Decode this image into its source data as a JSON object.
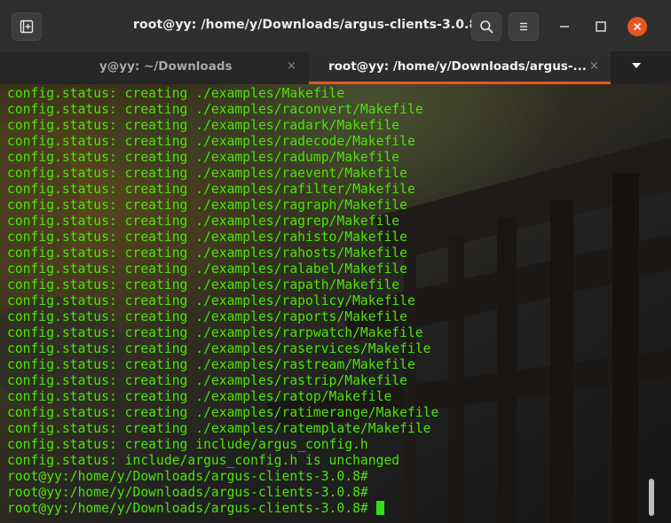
{
  "window": {
    "title": "root@yy: /home/y/Downloads/argus-clients-3.0.8"
  },
  "titlebar": {
    "new_tab_icon": "new-tab-icon",
    "search_icon": "search-icon",
    "menu_icon": "hamburger-menu-icon",
    "minimize_icon": "minimize-icon",
    "maximize_icon": "maximize-icon",
    "close_icon": "close-icon"
  },
  "tabs": [
    {
      "label": "y@yy: ~/Downloads",
      "close": "×",
      "active": false
    },
    {
      "label": "root@yy: /home/y/Downloads/argus-...",
      "close": "×",
      "active": true
    }
  ],
  "terminal": {
    "lines": [
      "config.status: creating ./examples/Makefile",
      "config.status: creating ./examples/raconvert/Makefile",
      "config.status: creating ./examples/radark/Makefile",
      "config.status: creating ./examples/radecode/Makefile",
      "config.status: creating ./examples/radump/Makefile",
      "config.status: creating ./examples/raevent/Makefile",
      "config.status: creating ./examples/rafilter/Makefile",
      "config.status: creating ./examples/ragraph/Makefile",
      "config.status: creating ./examples/ragrep/Makefile",
      "config.status: creating ./examples/rahisto/Makefile",
      "config.status: creating ./examples/rahosts/Makefile",
      "config.status: creating ./examples/ralabel/Makefile",
      "config.status: creating ./examples/rapath/Makefile",
      "config.status: creating ./examples/rapolicy/Makefile",
      "config.status: creating ./examples/raports/Makefile",
      "config.status: creating ./examples/rarpwatch/Makefile",
      "config.status: creating ./examples/raservices/Makefile",
      "config.status: creating ./examples/rastream/Makefile",
      "config.status: creating ./examples/rastrip/Makefile",
      "config.status: creating ./examples/ratop/Makefile",
      "config.status: creating ./examples/ratimerange/Makefile",
      "config.status: creating ./examples/ratemplate/Makefile",
      "config.status: creating include/argus_config.h",
      "config.status: include/argus_config.h is unchanged",
      "root@yy:/home/y/Downloads/argus-clients-3.0.8#",
      "root@yy:/home/y/Downloads/argus-clients-3.0.8#",
      "root@yy:/home/y/Downloads/argus-clients-3.0.8# "
    ]
  },
  "colors": {
    "text_green": "#4de30b",
    "cursor_green": "#2ee21a",
    "accent_orange": "#e95420",
    "titlebar": "#2e2e2e"
  }
}
